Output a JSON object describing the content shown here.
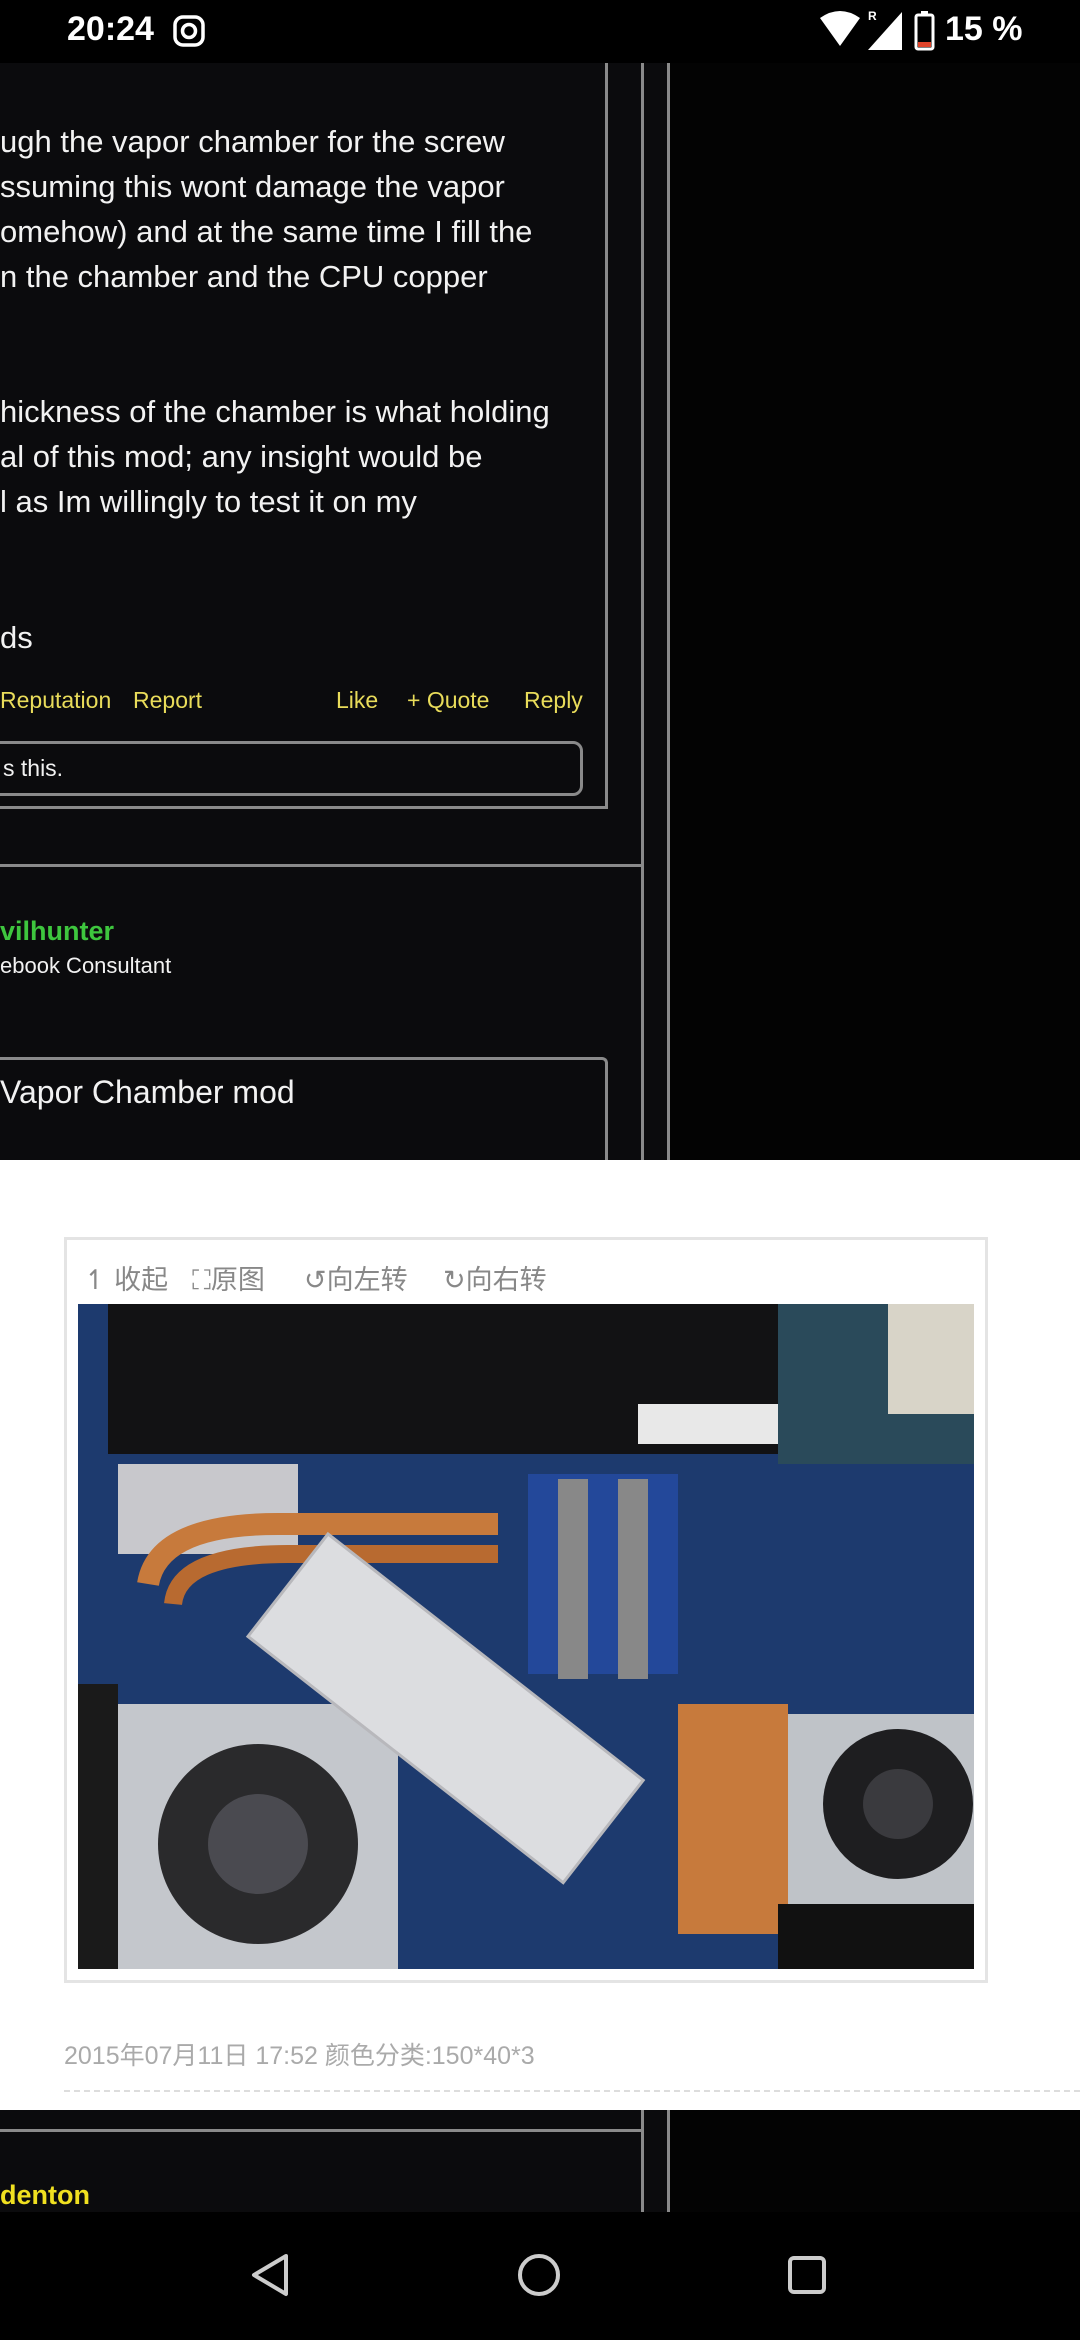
{
  "status_bar": {
    "time": "20:24",
    "battery": "15 %",
    "icons": [
      "instagram-icon",
      "wifi-icon",
      "signal-icon",
      "battery-icon"
    ]
  },
  "post": {
    "lines": [
      "ugh the vapor chamber for the screw",
      "ssuming this wont damage the vapor",
      "omehow) and at the same time I fill the",
      "n the chamber and the CPU copper",
      "hickness of the chamber is what holding",
      "al of this mod; any insight would be",
      "l as Im willingly to test it on my",
      "ds"
    ],
    "actions": {
      "reputation": "Reputation",
      "report": "Report",
      "like": "Like",
      "quote": "+ Quote",
      "reply": "Reply"
    },
    "likes_text": "s this."
  },
  "next_post": {
    "username": "vilhunter",
    "user_title": "ebook Consultant",
    "quote_title": "Vapor Chamber mod",
    "image_toolbar": [
      "收起",
      "原图",
      "向左转",
      "向右转"
    ],
    "image_caption": "2015年07月11日 17:52   颜色分类:150*40*3"
  },
  "third_post": {
    "username": "denton"
  },
  "colors": {
    "link": "#e9dc5a",
    "username_green": "#3ec63e",
    "username_yellow": "#f0e020"
  }
}
